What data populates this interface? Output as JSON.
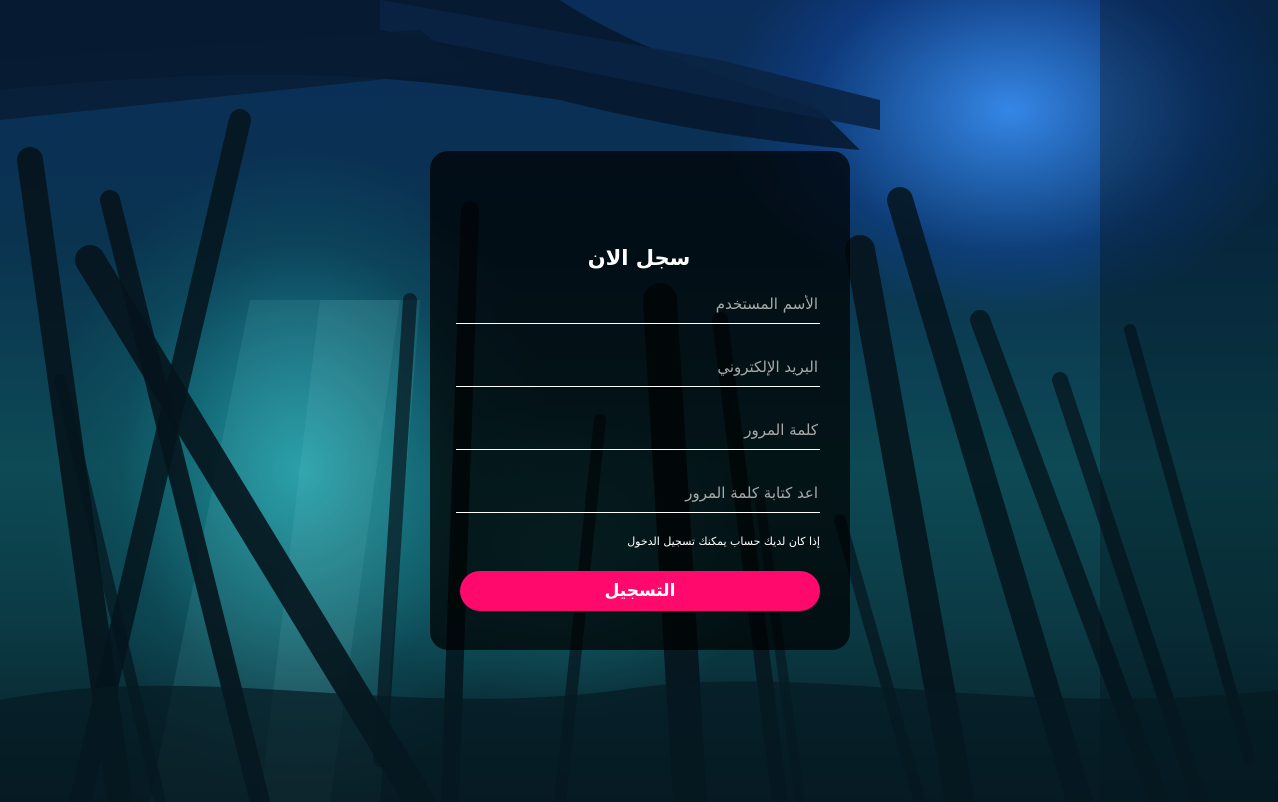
{
  "form": {
    "title": "سجل الان",
    "fields": [
      {
        "name": "username",
        "placeholder": "الأسم المستخدم",
        "type": "text"
      },
      {
        "name": "email",
        "placeholder": "البريد الإلكتروني",
        "type": "email"
      },
      {
        "name": "password",
        "placeholder": "كلمة المرور",
        "type": "password"
      },
      {
        "name": "confirm_password",
        "placeholder": "اعد كتابة كلمة المرور",
        "type": "password"
      }
    ],
    "login_prompt": "إذا كان لديك حساب يمكنك تسجيل الدخول",
    "submit_label": "التسجيل"
  },
  "colors": {
    "accent": "#ff0a6c",
    "card_background": "rgba(0,0,0,0.72)",
    "text": "#ffffff",
    "placeholder": "#a9a9a9"
  },
  "background": "underwater pier scene"
}
